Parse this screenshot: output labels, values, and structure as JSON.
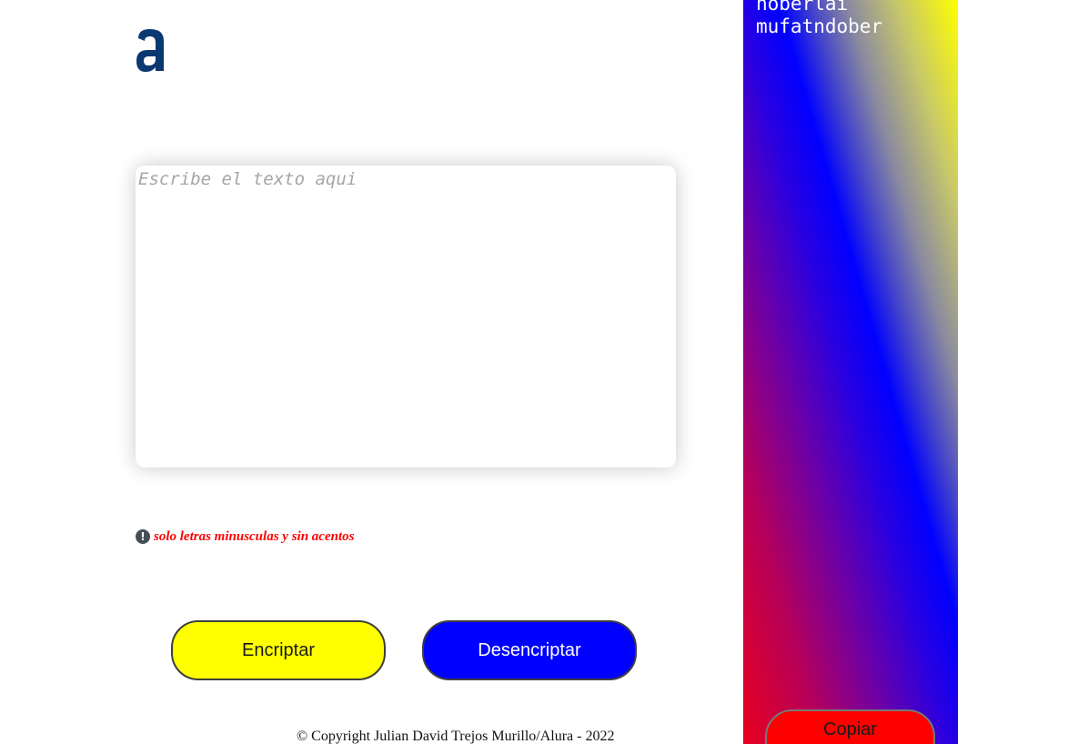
{
  "logo": {
    "icon": "alura-a-logo",
    "color": "#0a3871"
  },
  "input": {
    "placeholder": "Escribe el texto aqui",
    "value": ""
  },
  "warning": {
    "icon": "exclamation-circle-icon",
    "text": "solo letras minusculas y sin acentos",
    "color": "#ff0000"
  },
  "buttons": {
    "encrypt_label": "Encriptar",
    "decrypt_label": "Desencriptar",
    "copy_label": "Copiar"
  },
  "output": {
    "lines": [
      "noberlai",
      "mufatndober"
    ]
  },
  "footer": {
    "text": "© Copyright Julian David Trejos Murillo/Alura - 2022"
  },
  "colors": {
    "encrypt_button": "#ffff00",
    "decrypt_button": "#0000ff",
    "copy_button": "#ff0000",
    "panel_gradient": [
      "#e8001e",
      "#6a00a8",
      "#0000ff",
      "#ffff00"
    ]
  }
}
